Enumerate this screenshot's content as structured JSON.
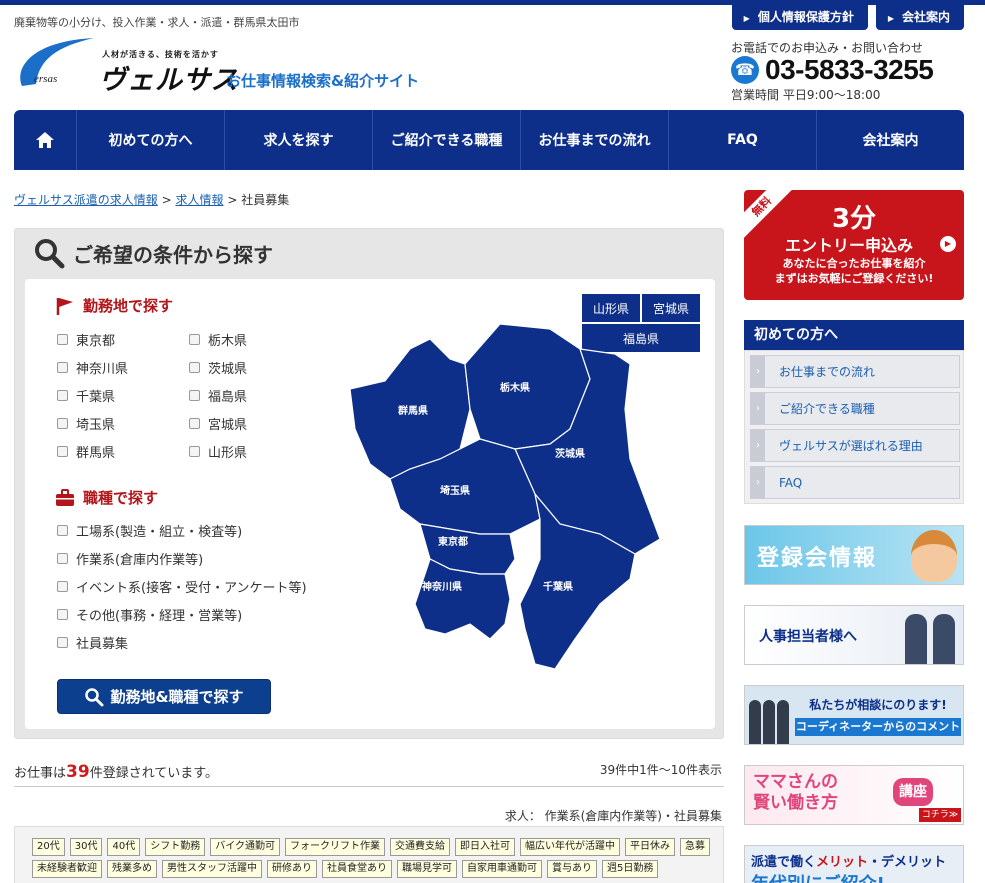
{
  "header": {
    "tagline": "廃棄物等の小分け、投入作業・求人・派遣・群馬県太田市",
    "top_links": [
      "個人情報保護方針",
      "会社案内"
    ],
    "logo_small": "人材が活きる、技術を活かす",
    "logo_main": "ヴェルサス",
    "logo_ersas": "ersas",
    "site_name": "お仕事情報検索&紹介サイト",
    "contact_label": "お電話でのお申込み・お問い合わせ",
    "phone": "03-5833-3255",
    "hours": "営業時間 平日9:00～18:00"
  },
  "nav": {
    "items": [
      "初めての方へ",
      "求人を探す",
      "ご紹介できる職種",
      "お仕事までの流れ",
      "FAQ",
      "会社案内"
    ]
  },
  "breadcrumb": {
    "items": [
      "ヴェルサス派遣の求人情報",
      "求人情報"
    ],
    "current": "社員募集",
    "separator": ">"
  },
  "search": {
    "title": "ご希望の条件から探す",
    "location_heading": "勤務地で探す",
    "locations_left": [
      "東京都",
      "神奈川県",
      "千葉県",
      "埼玉県",
      "群馬県"
    ],
    "locations_right": [
      "栃木県",
      "茨城県",
      "福島県",
      "宮城県",
      "山形県"
    ],
    "job_heading": "職種で探す",
    "jobs": [
      "工場系(製造・組立・検査等)",
      "作業系(倉庫内作業等)",
      "イベント系(接客・受付・アンケート等)",
      "その他(事務・経理・営業等)",
      "社員募集"
    ],
    "button": "勤務地&職種で探す",
    "pref_buttons": [
      "山形県",
      "宮城県",
      "福島県"
    ],
    "map_labels": [
      "群馬県",
      "栃木県",
      "茨城県",
      "埼玉県",
      "東京都",
      "神奈川県",
      "千葉県"
    ]
  },
  "results": {
    "count_prefix": "お仕事は",
    "count": "39",
    "count_suffix": "件登録されています。",
    "range": "39件中1件～10件表示",
    "job_category": "求人：  作業系(倉庫内作業等)・社員募集",
    "tags": [
      "20代",
      "30代",
      "40代",
      "シフト勤務",
      "バイク通勤可",
      "フォークリフト作業",
      "交通費支給",
      "即日入社可",
      "幅広い年代が活躍中",
      "平日休み",
      "急募",
      "未経験者歓迎",
      "残業多め",
      "男性スタッフ活躍中",
      "研修あり",
      "社員食堂あり",
      "職場見学可",
      "自家用車通勤可",
      "賞与あり",
      "週5日勤務"
    ]
  },
  "sidebar": {
    "entry_ribbon": "無料",
    "entry_big": "3分",
    "entry_mid": "エントリー申込み",
    "entry_small1": "あなたに合ったお仕事を紹介",
    "entry_small2": "まずはお気軽にご登録ください!",
    "menu_heading": "初めての方へ",
    "menu_items": [
      "お仕事までの流れ",
      "ご紹介できる職種",
      "ヴェルサスが選ばれる理由",
      "FAQ"
    ],
    "banner1": "登録会情報",
    "banner2": "人事担当者様へ",
    "banner3_line1": "私たちが相談にのります!",
    "banner3_line2": "コーディネーターからのコメント",
    "banner4_line1": "ママさんの",
    "banner4_line2": "賢い働き方",
    "banner4_badge": "講座",
    "banner4_more": "コチラ≫",
    "banner5_pre": "派遣で働く",
    "banner5_em": "メリット",
    "banner5_post": "・デメリット",
    "banner5_line2": "年代別にご紹介!"
  },
  "colors": {
    "navy": "#0d2f8a",
    "red": "#c8141b",
    "link": "#1b5fb0"
  }
}
